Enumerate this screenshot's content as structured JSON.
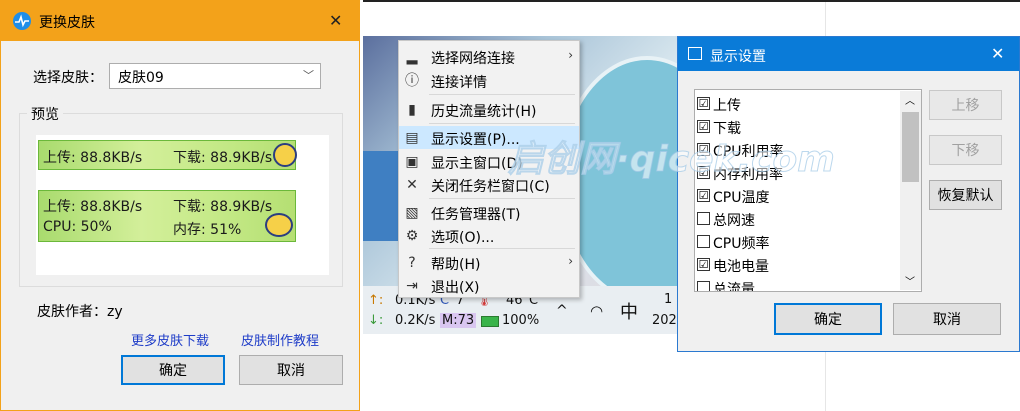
{
  "skin_dialog": {
    "title": "更换皮肤",
    "close": "✕",
    "select_label": "选择皮肤：",
    "selected_skin": "皮肤09",
    "preview_label": "预览",
    "preview1": {
      "up": "上传: 88.8KB/s",
      "down": "下载: 88.9KB/s"
    },
    "preview2": {
      "up": "上传: 88.8KB/s",
      "down": "下载: 88.9KB/s",
      "cpu": "CPU: 50%",
      "mem": "内存: 51%"
    },
    "author": "皮肤作者：zy",
    "link_more": "更多皮肤下载",
    "link_tutorial": "皮肤制作教程",
    "ok": "确定",
    "cancel": "取消"
  },
  "context_menu": {
    "items": [
      {
        "icon": "signal-icon",
        "glyph": "▂",
        "label": "选择网络连接",
        "submenu": true
      },
      {
        "icon": "info-icon",
        "glyph": "ⓘ",
        "label": "连接详情"
      },
      {
        "icon": "chart-icon",
        "glyph": "▮",
        "label": "历史流量统计(H)"
      },
      {
        "icon": "display-icon",
        "glyph": "▤",
        "label": "显示设置(P)..."
      },
      {
        "icon": "window-icon",
        "glyph": "▣",
        "label": "显示主窗口(D)"
      },
      {
        "icon": "close-icon",
        "glyph": "✕",
        "label": "关闭任务栏窗口(C)"
      },
      {
        "icon": "task-manager-icon",
        "glyph": "▧",
        "label": "任务管理器(T)"
      },
      {
        "icon": "gear-icon",
        "glyph": "⚙",
        "label": "选项(O)..."
      },
      {
        "icon": "help-icon",
        "glyph": "?",
        "label": "帮助(H)",
        "submenu": true
      },
      {
        "icon": "exit-icon",
        "glyph": "⇥",
        "label": "退出(X)"
      }
    ]
  },
  "taskbar": {
    "row1": {
      "up": "0.1K/s",
      "c": "C",
      "temp_c": "7",
      "gpu_temp": "46°C"
    },
    "row2": {
      "down": "0.2K/s",
      "m": "M:73",
      "battery": "100%"
    },
    "ime": "中",
    "date_partial": "202",
    "time_partial": "1",
    "up_arrow": "↑:",
    "down_arrow": "↓:",
    "caret": "^"
  },
  "display_settings": {
    "title": "显示设置",
    "close": "✕",
    "items": [
      {
        "label": "上传",
        "checked": "☑"
      },
      {
        "label": "下载",
        "checked": "☑"
      },
      {
        "label": "CPU利用率",
        "checked": "☑"
      },
      {
        "label": "内存利用率",
        "checked": "☑"
      },
      {
        "label": "CPU温度",
        "checked": "☑"
      },
      {
        "label": "总网速",
        "checked": ""
      },
      {
        "label": "CPU频率",
        "checked": ""
      },
      {
        "label": "电池电量",
        "checked": "☑"
      },
      {
        "label": "总流量",
        "checked": ""
      }
    ],
    "move_up": "上移",
    "move_down": "下移",
    "restore": "恢复默认",
    "ok": "确定",
    "cancel": "取消"
  },
  "watermark": "启创网·qicek.com"
}
